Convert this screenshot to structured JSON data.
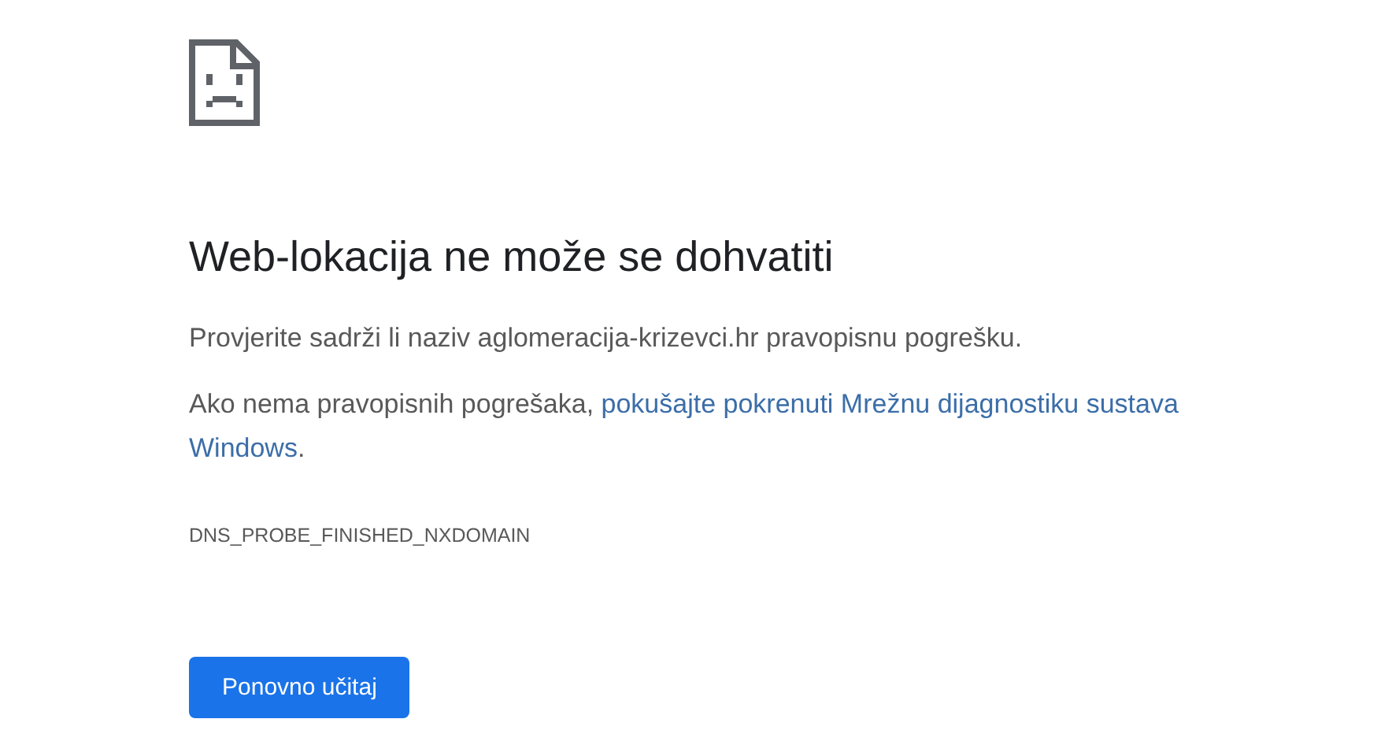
{
  "title": "Web-lokacija ne može se dohvatiti",
  "suggestion": "Provjerite sadrži li naziv aglomeracija-krizevci.hr pravopisnu pogrešku.",
  "diagnostics": {
    "text": "Ako nema pravopisnih pogrešaka,",
    "link_lines": [
      "pokušajte pokrenuti Mrežnu dijagnostiku sustava",
      "Windows"
    ],
    "end": "."
  },
  "error_code": "DNS_PROBE_FINISHED_NXDOMAIN",
  "reload_button": "Ponovno učitaj"
}
